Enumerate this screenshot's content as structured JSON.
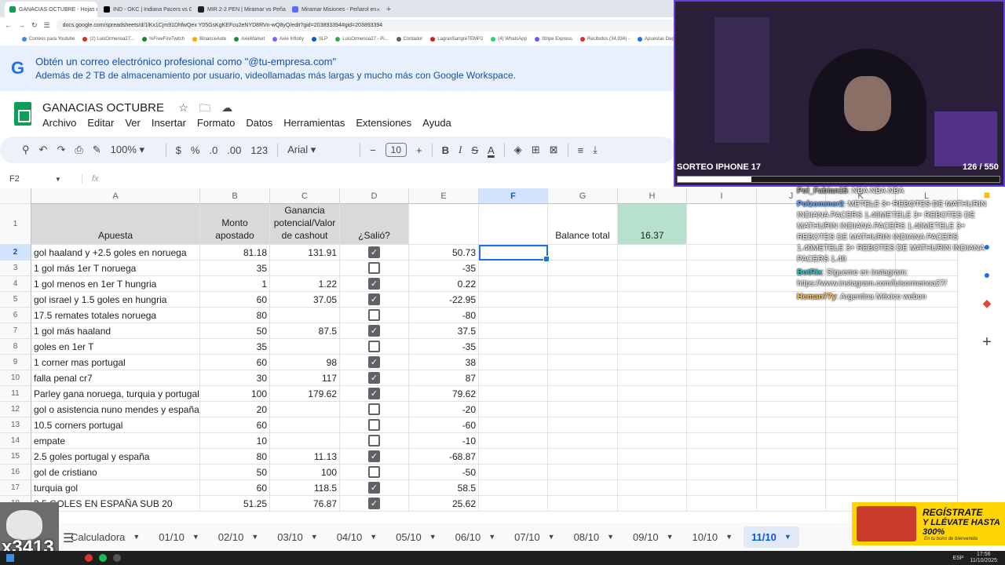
{
  "browser": {
    "tabs": [
      {
        "label": "GANACIAS OCTUBRE - Hojas de",
        "color": "#0f9d58",
        "active": true
      },
      {
        "label": "IND - OKC | Indiana Pacers vs O",
        "color": "#000000",
        "active": false
      },
      {
        "label": "MIR 2-2 PEN | Miramar vs Peña",
        "color": "#222222",
        "active": false
      },
      {
        "label": "Miramar Misiones - Peñarol en",
        "color": "#5b6cff",
        "active": false
      }
    ],
    "new_tab": "+",
    "url": "docs.google.com/spreadsheets/d/1lKx1Cjm91DhfwQex Y05GsKgKEFcu2eNYD8RVn-wQ8yQ/edit?gid=203893394#gid=203893394",
    "bookmarks": [
      "Correos para Youtube",
      "(2) LuisOrmenoa27...",
      "%FreeFireTwitch",
      "BinanceAute",
      "AxieMarket",
      "Axie Infinity",
      "SLP",
      "LuisOrmenoa27 - Pi...",
      "Contador",
      "LagranSangreTEMP2",
      "(4) WhatsApp",
      "Stripe Express",
      "Recibidos (34,934) -",
      "Apuestas Depo"
    ]
  },
  "banner": {
    "line1": "Obtén un correo electrónico profesional como \"@tu-empresa.com\"",
    "line2": "Además de 2 TB de almacenamiento por usuario, videollamadas más largas y mucho más con Google Workspace."
  },
  "doc": {
    "title": "GANACIAS OCTUBRE",
    "menus": [
      "Archivo",
      "Editar",
      "Ver",
      "Insertar",
      "Formato",
      "Datos",
      "Herramientas",
      "Extensiones",
      "Ayuda"
    ]
  },
  "toolbar": {
    "zoom": "100%",
    "currency": "$",
    "percent": "%",
    "dec_minus": ".0",
    "dec_plus": ".00",
    "number_format": "123",
    "font": "Arial",
    "font_size": "10",
    "bold": "B",
    "italic": "I",
    "strike": "S",
    "text_color": "A"
  },
  "formula_bar": {
    "name_box": "F2",
    "fx": "fx"
  },
  "sheet": {
    "columns": [
      "A",
      "B",
      "C",
      "D",
      "E",
      "F",
      "G",
      "H",
      "I",
      "J",
      "K",
      "L"
    ],
    "selected_column": "F",
    "selected_row": "2",
    "headers": {
      "A": "Apuesta",
      "B": "Monto apostado",
      "C": "Ganancia potencial/Valor de cashout",
      "D": "¿Salió?",
      "G": "Balance total",
      "H": "16.37"
    },
    "rows": [
      {
        "n": "2",
        "a": "gol haaland y +2.5 goles en noruega",
        "b": "81.18",
        "c": "131.91",
        "d": true,
        "e": "50.73"
      },
      {
        "n": "3",
        "a": "1 gol más 1er T noruega",
        "b": "35",
        "c": "",
        "d": false,
        "e": "-35"
      },
      {
        "n": "4",
        "a": "1 gol menos en 1er T hungria",
        "b": "1",
        "c": "1.22",
        "d": true,
        "e": "0.22"
      },
      {
        "n": "5",
        "a": "gol israel y 1.5 goles en hungria",
        "b": "60",
        "c": "37.05",
        "d": true,
        "e": "-22.95"
      },
      {
        "n": "6",
        "a": "17.5 remates totales noruega",
        "b": "80",
        "c": "",
        "d": false,
        "e": "-80"
      },
      {
        "n": "7",
        "a": "1 gol más haaland",
        "b": "50",
        "c": "87.5",
        "d": true,
        "e": "37.5"
      },
      {
        "n": "8",
        "a": "goles en 1er T",
        "b": "35",
        "c": "",
        "d": false,
        "e": "-35"
      },
      {
        "n": "9",
        "a": "1 corner mas portugal",
        "b": "60",
        "c": "98",
        "d": true,
        "e": "38"
      },
      {
        "n": "10",
        "a": "falla penal cr7",
        "b": "30",
        "c": "117",
        "d": true,
        "e": "87"
      },
      {
        "n": "11",
        "a": "Parley gana noruega, turquia y portugal",
        "b": "100",
        "c": "179.62",
        "d": true,
        "e": "79.62"
      },
      {
        "n": "12",
        "a": "gol o asistencia nuno mendes y españa",
        "b": "20",
        "c": "",
        "d": false,
        "e": "-20"
      },
      {
        "n": "13",
        "a": "10.5 corners portugal",
        "b": "60",
        "c": "",
        "d": false,
        "e": "-60"
      },
      {
        "n": "14",
        "a": "empate",
        "b": "10",
        "c": "",
        "d": false,
        "e": "-10"
      },
      {
        "n": "15",
        "a": "2.5 goles portugal y españa",
        "b": "80",
        "c": "11.13",
        "d": true,
        "e": "-68.87"
      },
      {
        "n": "16",
        "a": "gol de cristiano",
        "b": "50",
        "c": "100",
        "d": false,
        "e": "-50"
      },
      {
        "n": "17",
        "a": "turquia gol",
        "b": "60",
        "c": "118.5",
        "d": true,
        "e": "58.5"
      },
      {
        "n": "18",
        "a": "3.5 GOLES EN ESPAÑA SUB 20",
        "b": "51.25",
        "c": "76.87",
        "d": true,
        "e": "25.62"
      }
    ]
  },
  "sheet_tabs": [
    "Calculadora",
    "01/10",
    "02/10",
    "03/10",
    "04/10",
    "05/10",
    "06/10",
    "07/10",
    "08/10",
    "09/10",
    "10/10",
    "11/10"
  ],
  "active_sheet_tab": "11/10",
  "stream": {
    "overlay_title": "SORTEO IPHONE 17",
    "overlay_count": "126 / 550",
    "progress_fraction": 0.229,
    "chat": [
      {
        "user": "Pol_Fabian15",
        "text": ": NBA NBA NBA"
      },
      {
        "user": "Polzommer2",
        "text": ": METELE 3+ REBOTES DE MATHURIN INDIANA PACERS 1.40METELE 3+ REBOTES DE MATHURIN INDIANA PACERS 1.40METELE 3+ REBOTES DE MATHURIN INDIANA PACERS 1.40METELE 3+ REBOTES DE MATHURIN INDIANA PACERS 1.40"
      },
      {
        "user": "BotRix",
        "text": ": Sígueme en instagram: https://www.instagram.com/luisormenoa27/"
      },
      {
        "user": "Heman77y",
        "text": ": Argentina México webon"
      }
    ],
    "promo": {
      "line1": "REGÍSTRATE",
      "line2": "Y LLÉVATE HASTA 300%",
      "line3": "En tu bono de bienvenida"
    },
    "cam_text": "x3413"
  },
  "taskbar": {
    "lang": "ESP",
    "time": "17:56",
    "date": "11/10/2025"
  }
}
